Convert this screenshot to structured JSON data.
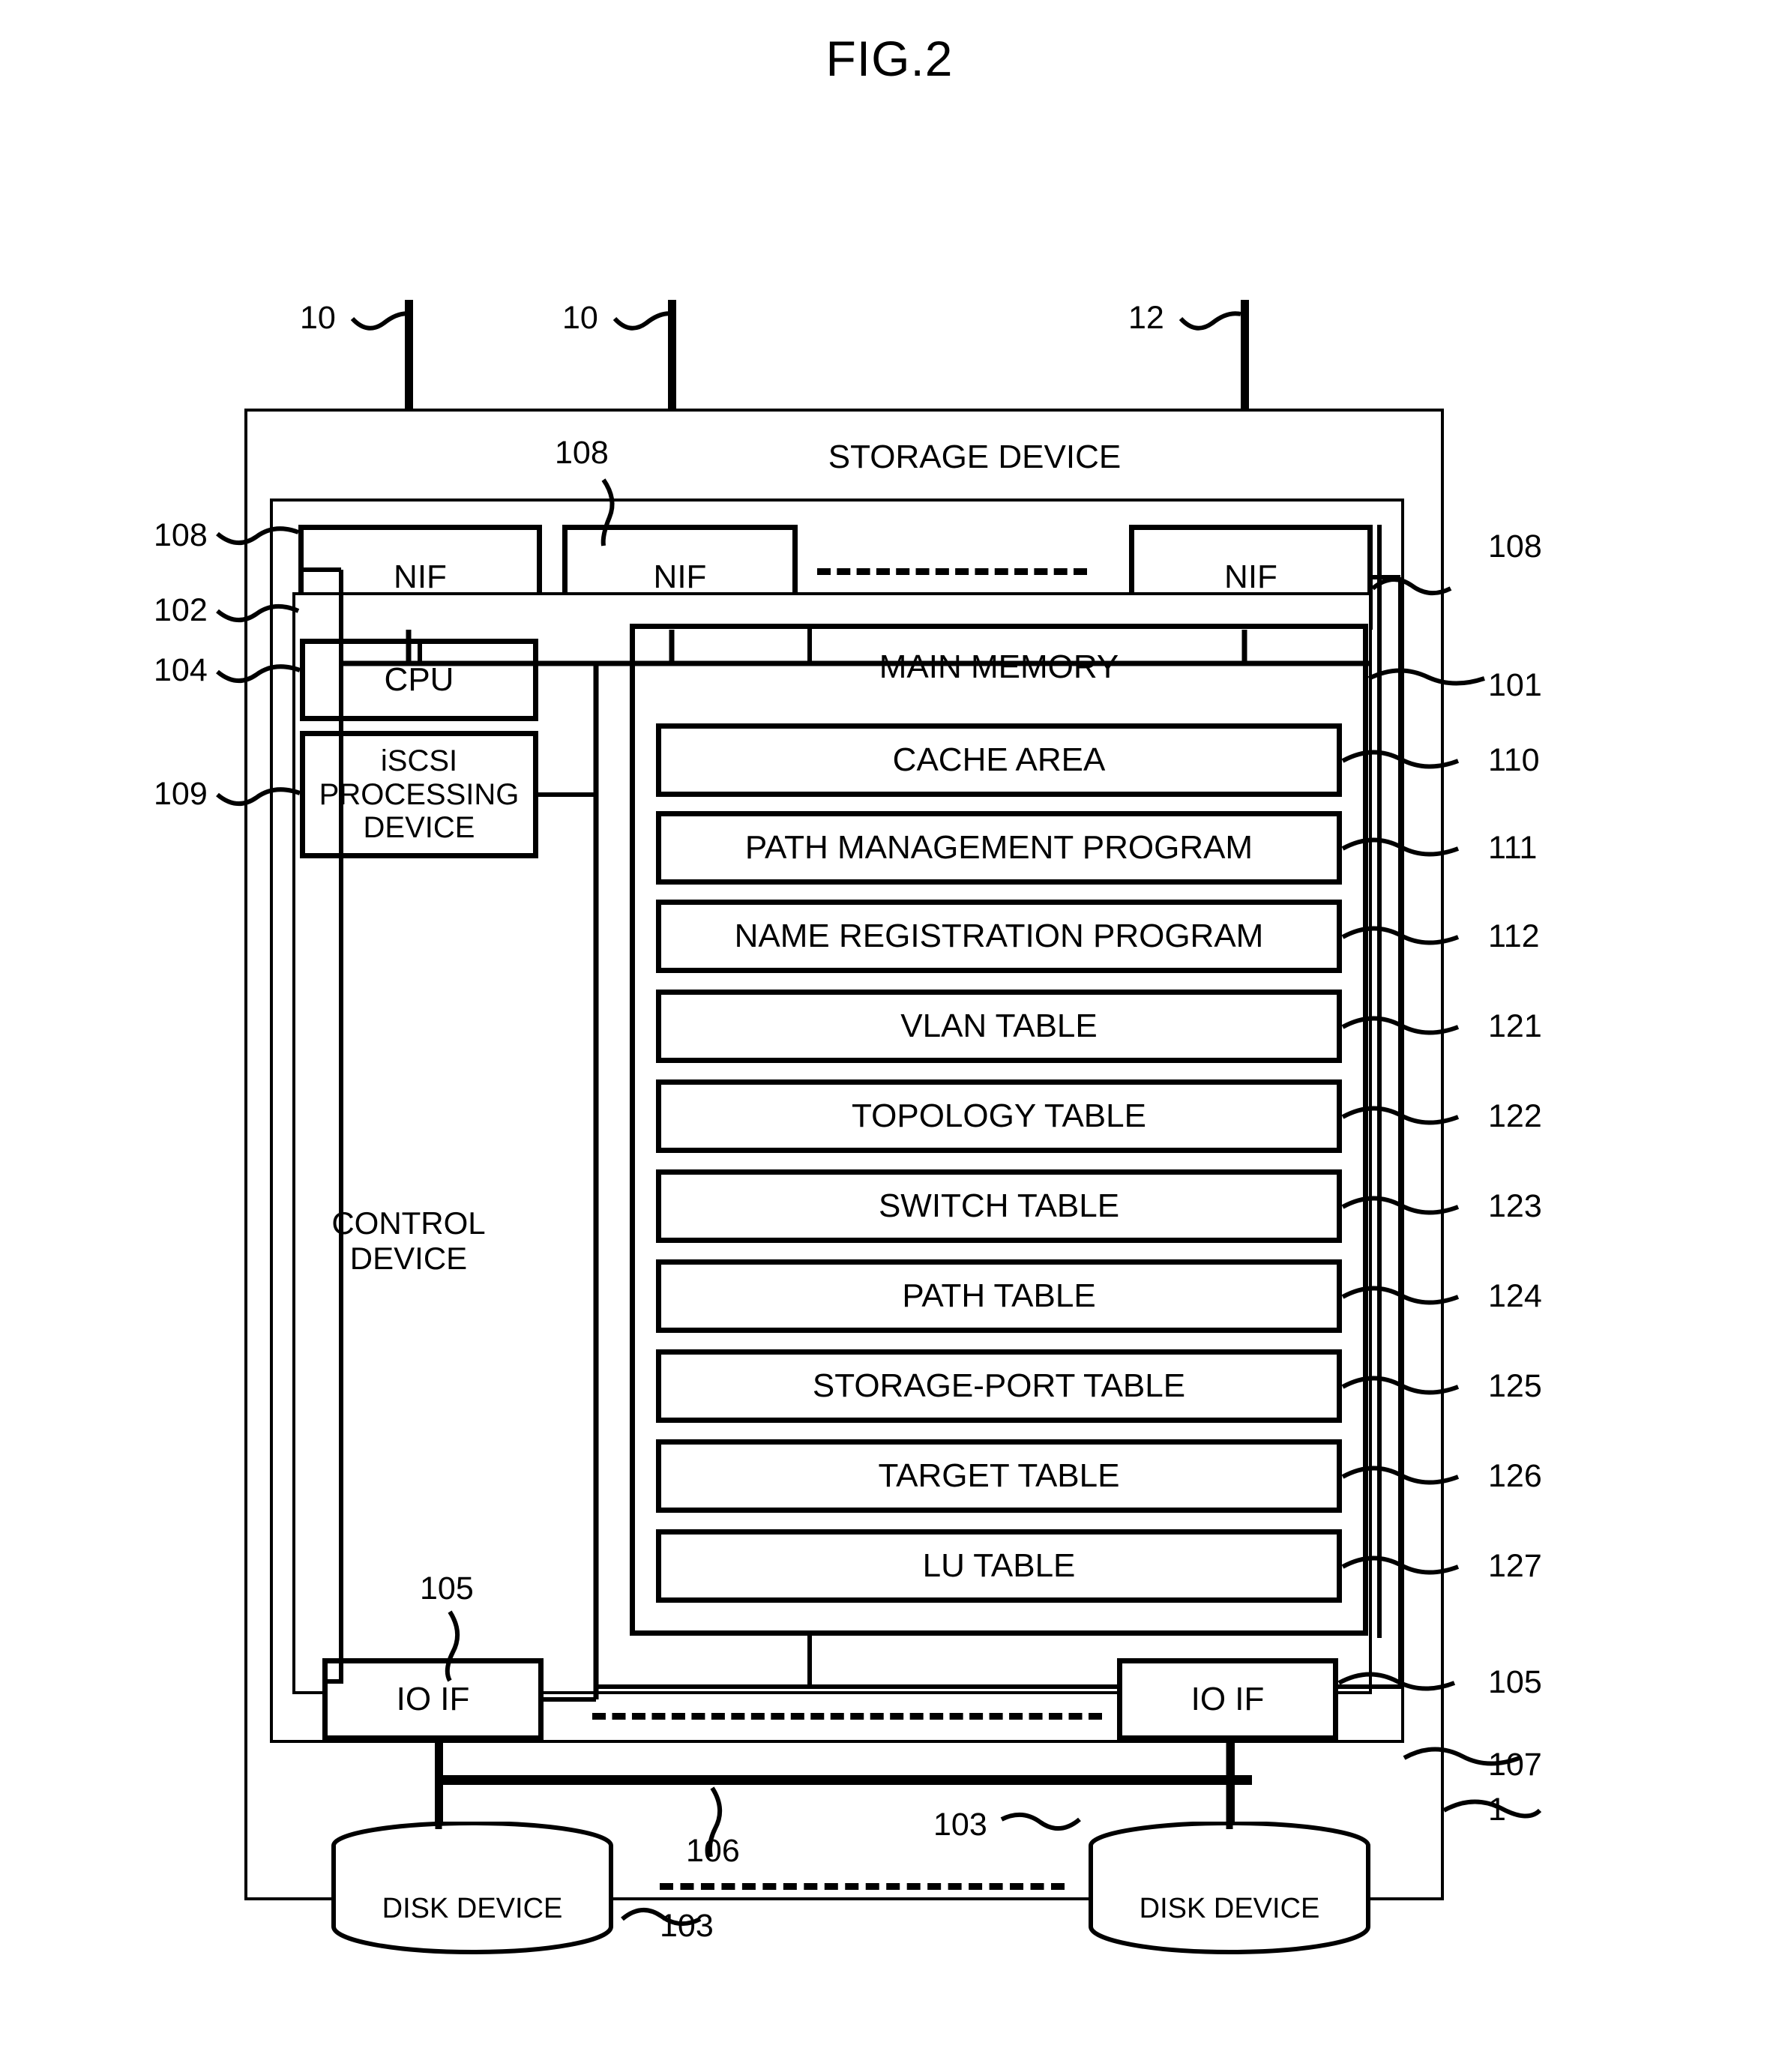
{
  "figure": {
    "title": "FIG.2"
  },
  "outer": {
    "ref": "1"
  },
  "storage_device": {
    "label": "STORAGE DEVICE",
    "ref": "107"
  },
  "nifs": [
    {
      "label": "NIF",
      "ref_left": "108"
    },
    {
      "label": "NIF",
      "ref_top": "108"
    },
    {
      "label": "NIF",
      "ref_right": "108"
    }
  ],
  "network_lines": [
    {
      "ref": "10"
    },
    {
      "ref": "10"
    },
    {
      "ref": "12"
    }
  ],
  "control_device": {
    "label": "CONTROL DEVICE",
    "ref": "102",
    "cpu": {
      "label": "CPU",
      "ref": "104"
    },
    "iscsi": {
      "label": "iSCSI PROCESSING DEVICE",
      "ref": "109"
    }
  },
  "main_memory": {
    "label": "MAIN MEMORY",
    "ref": "101",
    "items": [
      {
        "label": "CACHE AREA",
        "ref": "110"
      },
      {
        "label": "PATH MANAGEMENT PROGRAM",
        "ref": "111"
      },
      {
        "label": "NAME REGISTRATION PROGRAM",
        "ref": "112"
      },
      {
        "label": "VLAN TABLE",
        "ref": "121"
      },
      {
        "label": "TOPOLOGY TABLE",
        "ref": "122"
      },
      {
        "label": "SWITCH TABLE",
        "ref": "123"
      },
      {
        "label": "PATH TABLE",
        "ref": "124"
      },
      {
        "label": "STORAGE-PORT TABLE",
        "ref": "125"
      },
      {
        "label": "TARGET TABLE",
        "ref": "126"
      },
      {
        "label": "LU TABLE",
        "ref": "127"
      }
    ]
  },
  "io_ifs": [
    {
      "label": "IO IF",
      "ref": "105"
    },
    {
      "label": "IO IF",
      "ref": "105"
    }
  ],
  "disk_devices": [
    {
      "label": "DISK DEVICE",
      "ref": "103"
    },
    {
      "label": "DISK DEVICE",
      "ref": "103"
    }
  ],
  "disk_bus": {
    "ref": "106"
  }
}
